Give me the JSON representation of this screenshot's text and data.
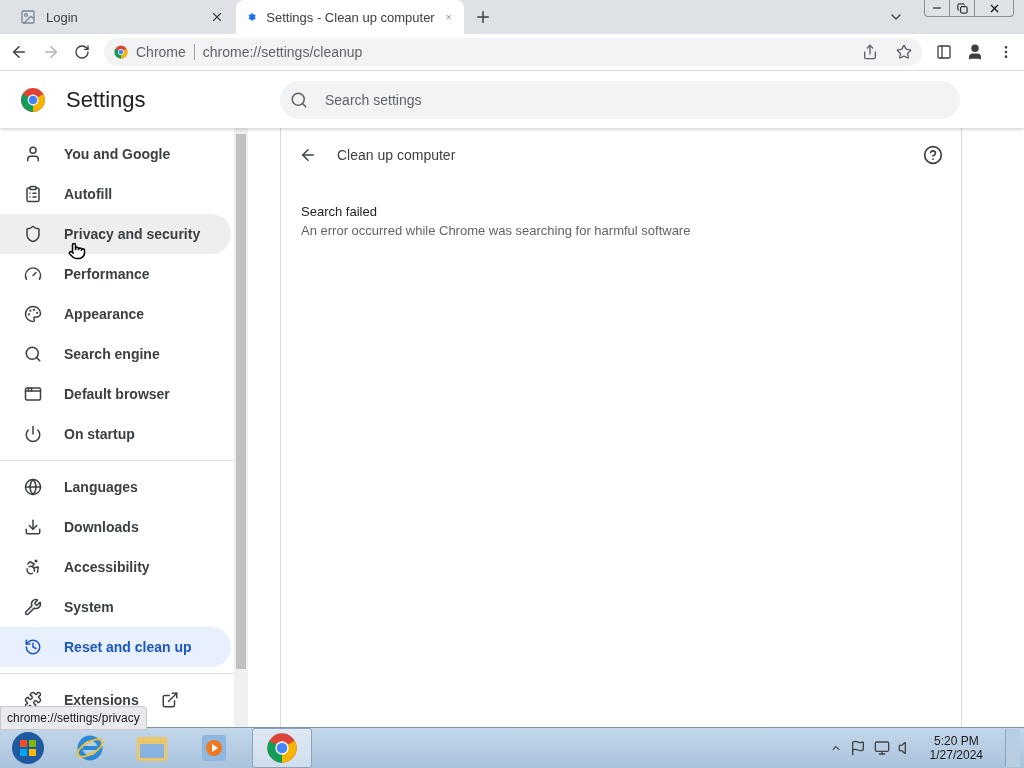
{
  "tabs": [
    {
      "title": "Login",
      "selected": false
    },
    {
      "title": "Settings - Clean up computer",
      "selected": true
    }
  ],
  "address_bar": {
    "site": "Chrome",
    "url": "chrome://settings/cleanup"
  },
  "settings": {
    "title": "Settings",
    "search": {
      "placeholder": "Search settings"
    }
  },
  "sidebar": {
    "groups": [
      [
        {
          "label": "You and Google",
          "selected": false,
          "hovered": false
        },
        {
          "label": "Autofill",
          "selected": false,
          "hovered": false
        },
        {
          "label": "Privacy and security",
          "selected": false,
          "hovered": true
        },
        {
          "label": "Performance",
          "selected": false,
          "hovered": false
        },
        {
          "label": "Appearance",
          "selected": false,
          "hovered": false
        },
        {
          "label": "Search engine",
          "selected": false,
          "hovered": false
        },
        {
          "label": "Default browser",
          "selected": false,
          "hovered": false
        },
        {
          "label": "On startup",
          "selected": false,
          "hovered": false
        }
      ],
      [
        {
          "label": "Languages",
          "selected": false,
          "hovered": false
        },
        {
          "label": "Downloads",
          "selected": false,
          "hovered": false
        },
        {
          "label": "Accessibility",
          "selected": false,
          "hovered": false
        },
        {
          "label": "System",
          "selected": false,
          "hovered": false
        },
        {
          "label": "Reset and clean up",
          "selected": true,
          "hovered": false
        }
      ],
      [
        {
          "label": "Extensions",
          "selected": false,
          "hovered": false
        }
      ]
    ]
  },
  "page": {
    "title": "Clean up computer",
    "status": {
      "heading": "Search failed",
      "message": "An error occurred while Chrome was searching for harmful software"
    }
  },
  "status_bubble": "chrome://settings/privacy",
  "taskbar": {
    "clock": {
      "time": "5:20 PM",
      "date": "1/27/2024"
    }
  }
}
